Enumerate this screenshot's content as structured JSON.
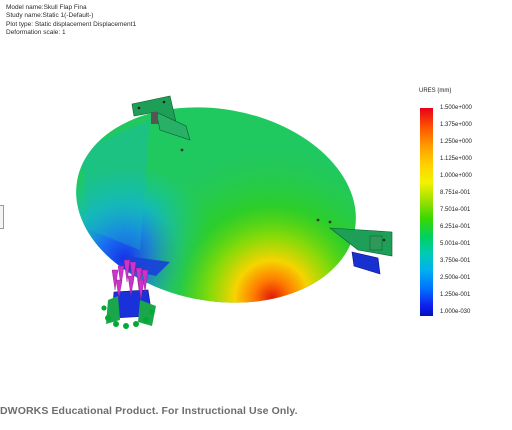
{
  "header": {
    "model": "Model name:Skull Flap Fina",
    "study": "Study name:Static 1(-Default-)",
    "plot_type": "Plot type: Static displacement Displacement1",
    "deformation": "Deformation scale: 1"
  },
  "legend": {
    "title": "URES (mm)",
    "ticks": [
      "1.500e+000",
      "1.375e+000",
      "1.250e+000",
      "1.125e+000",
      "1.000e+000",
      "8.751e-001",
      "7.501e-001",
      "6.251e-001",
      "5.001e-001",
      "3.750e-001",
      "2.500e-001",
      "1.250e-001",
      "1.000e-030"
    ]
  },
  "footer": {
    "watermark": "DWORKS Educational Product. For Instructional Use Only."
  },
  "colors": {
    "max": "#e8001a",
    "mid": "#3ad800",
    "min": "#0014b8",
    "support_plate": "#1aa64a",
    "fixture_arrows": "#cc33cc",
    "load_marker": "#00aa33"
  }
}
